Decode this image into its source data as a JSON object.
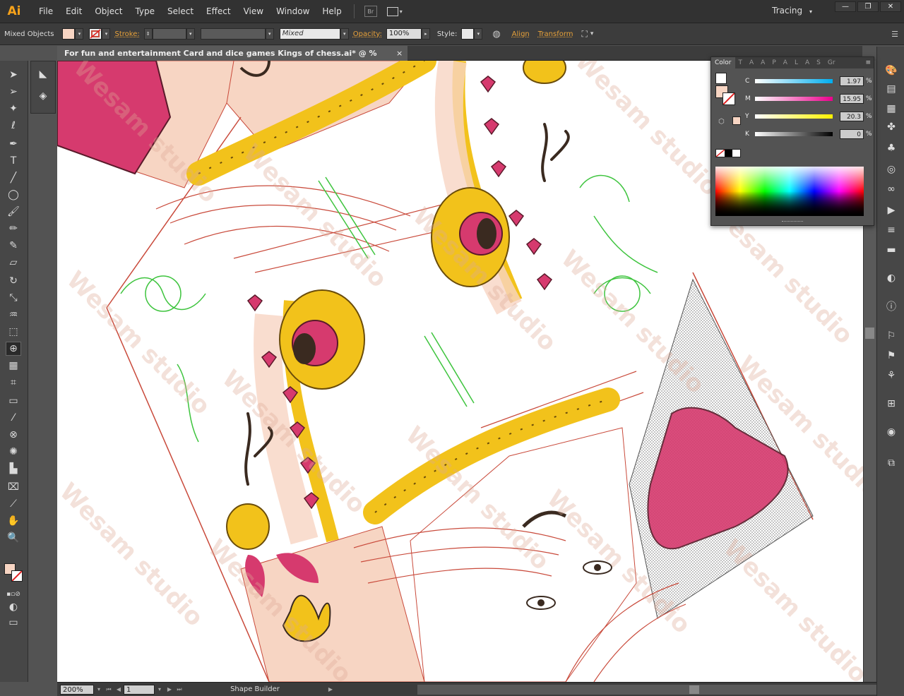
{
  "app": {
    "logo": "Ai"
  },
  "menu": [
    "File",
    "Edit",
    "Object",
    "Type",
    "Select",
    "Effect",
    "View",
    "Window",
    "Help"
  ],
  "bridge_label": "Br",
  "workspace": {
    "label": "Tracing"
  },
  "control": {
    "selection_label": "Mixed Objects",
    "stroke_label": "Stroke:",
    "brush_value": "Mixed",
    "opacity_label": "Opacity:",
    "opacity_value": "100%",
    "style_label": "Style:",
    "align_label": "Align",
    "transform_label": "Transform"
  },
  "document": {
    "tab_title": "For fun and entertainment Card and dice games Kings of chess.ai* @ % (CMYK/Preview)",
    "close": "×"
  },
  "status": {
    "zoom": "200%",
    "page": "1",
    "tool": "Shape Builder"
  },
  "color_panel": {
    "tab_active": "Color",
    "tabs_other": [
      "T",
      "A",
      "A",
      "P",
      "A",
      "L",
      "A",
      "S",
      "Gr"
    ],
    "channels": [
      {
        "letter": "C",
        "value": "1.97",
        "pct": "%"
      },
      {
        "letter": "M",
        "value": "15.95",
        "pct": "%"
      },
      {
        "letter": "Y",
        "value": "20.3",
        "pct": "%"
      },
      {
        "letter": "K",
        "value": "0",
        "pct": "%"
      }
    ]
  },
  "watermark": {
    "text": "Wesam studio"
  },
  "colors": {
    "fill": "#f7d5c3",
    "heart": "#d63a6e",
    "gold": "#f2c21b",
    "stroke": "#c94a3b",
    "green": "#3ec43e"
  }
}
